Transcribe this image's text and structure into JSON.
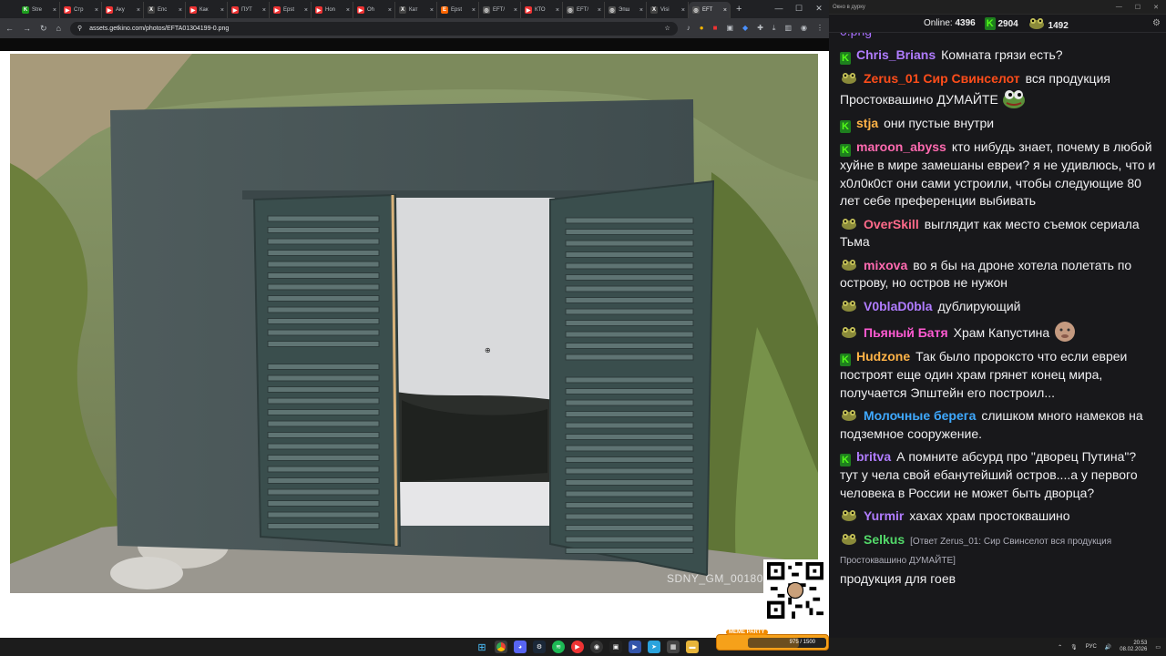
{
  "browser": {
    "tabs": [
      {
        "label": "Stre",
        "color": "#1e9e1e",
        "glyph": "K"
      },
      {
        "label": "Стр",
        "color": "#e33",
        "glyph": "▶"
      },
      {
        "label": "Аку",
        "color": "#e33",
        "glyph": "▶"
      },
      {
        "label": "Епс",
        "color": "#444",
        "glyph": "X"
      },
      {
        "label": "Как",
        "color": "#e33",
        "glyph": "▶"
      },
      {
        "label": "ПУТ",
        "color": "#e33",
        "glyph": "▶"
      },
      {
        "label": "Epst",
        "color": "#e33",
        "glyph": "▶"
      },
      {
        "label": "Hon",
        "color": "#e33",
        "glyph": "▶"
      },
      {
        "label": "Oh",
        "color": "#e33",
        "glyph": "▶"
      },
      {
        "label": "Кат",
        "color": "#444",
        "glyph": "X"
      },
      {
        "label": "Epst",
        "color": "#f60",
        "glyph": "E"
      },
      {
        "label": "EFT/",
        "color": "#555",
        "glyph": "◎"
      },
      {
        "label": "КТО",
        "color": "#e33",
        "glyph": "▶"
      },
      {
        "label": "EFT/",
        "color": "#555",
        "glyph": "◎"
      },
      {
        "label": "Эпш",
        "color": "#555",
        "glyph": "◎"
      },
      {
        "label": "Visi",
        "color": "#444",
        "glyph": "X"
      },
      {
        "label": "EFT",
        "color": "#555",
        "glyph": "◎",
        "active": true
      }
    ],
    "new_tab": "+",
    "url": "assets.getkino.com/photos/EFTA01304199-0.png",
    "win_min": "—",
    "win_max": "☐",
    "win_close": "✕"
  },
  "photo": {
    "caption": "SDNY_GM_00180"
  },
  "chat": {
    "window_title": "Окно в дурку",
    "online_label": "Online:",
    "online_count": "4396",
    "kick_count": "2904",
    "frog_count": "1492",
    "messages": [
      {
        "badge": "frog",
        "user": "",
        "color": "#a970ff",
        "text": "0.png",
        "partial": true
      },
      {
        "badge": "kick",
        "user": "Chris_Brians",
        "color": "#b07cff",
        "text": "Комната грязи есть?"
      },
      {
        "badge": "frog",
        "user": "Zerus_01 Сир Свинселот",
        "color": "#ff4d1a",
        "text": "вся продукция Простоквашино ДУМАЙТЕ",
        "emote": "pepe"
      },
      {
        "badge": "kick",
        "user": "stja",
        "color": "#ffb347",
        "text": "они пустые внутри"
      },
      {
        "badge": "kick",
        "user": "maroon_abyss",
        "color": "#ff6ab0",
        "text": "кто нибудь знает, почему в любой хуйне в мире замешаны евреи? я не удивлюсь, что и х0л0к0ст они сами устроили, чтобы следующие 80 лет себе преференции выбивать"
      },
      {
        "badge": "frog",
        "user": "OverSkill",
        "color": "#ff6a8a",
        "text": "выглядит как место съемок сериала Тьма"
      },
      {
        "badge": "frog",
        "user": "mixova",
        "color": "#ff6ab0",
        "text": "во я бы на дроне хотела полетать по острову, но остров не нужон"
      },
      {
        "badge": "frog",
        "user": "V0blaD0bla",
        "color": "#b07cff",
        "text": "дублирующий"
      },
      {
        "badge": "frog",
        "user": "Пьяный Батя",
        "color": "#ff5ad2",
        "text": "Храм Капустина",
        "emote": "face"
      },
      {
        "badge": "kick",
        "user": "Hudzone",
        "color": "#ffb347",
        "text": "Так было пророксто что если евреи построят еще один храм грянет конец мира, получается Эпштейн его построил..."
      },
      {
        "badge": "frog",
        "user": "Молочные берега",
        "color": "#3fa9ff",
        "text": "слишком много намеков на подземное сооружение."
      },
      {
        "badge": "kick",
        "user": "britva",
        "color": "#b07cff",
        "text": "А помните абсурд про \"дворец Путина\"? тут у чела свой ебанутейший остров....а у первого человека в России не может быть дворца?"
      },
      {
        "badge": "frog",
        "user": "Yurmir",
        "color": "#b07cff",
        "text": "хахах храм простоквашино"
      },
      {
        "badge": "frog",
        "user": "Selkus",
        "color": "#53d96a",
        "small": "[Ответ Zerus_01: Сир Свинселот  вся продукция Простоквашино ДУМАЙТЕ]",
        "text": "продукция для гоев"
      }
    ]
  },
  "taskbar": {
    "meme_label": "MEME PARTY",
    "meme_progress": "975 / 1500",
    "meme_fraction": 0.65,
    "lang": "РУС",
    "time": "20:53",
    "date": "08.02.2026"
  }
}
